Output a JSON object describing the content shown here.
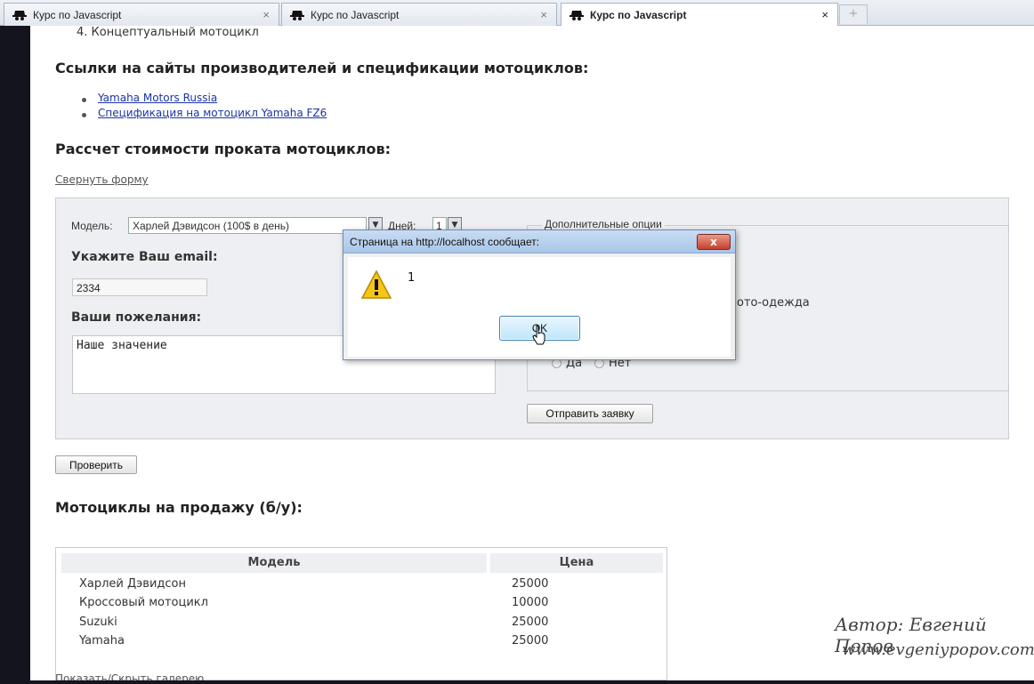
{
  "tabs": [
    {
      "title": "Курс по Javascript",
      "close": "×"
    },
    {
      "title": "Курс по Javascript",
      "close": "×"
    },
    {
      "title": "Курс по Javascript",
      "close": "×"
    }
  ],
  "new_tab": "+",
  "page": {
    "list_item_4": "4.  Концептуальный мотоцикл",
    "links_heading": "Ссылки на сайты производителей и спецификации мотоциклов:",
    "links": [
      "Yamaha Motors Russia",
      "Спецификация на мотоцикл Yamaha FZ6"
    ],
    "calc_heading": "Рассчет стоимости проката мотоциклов:",
    "collapse_link": "Свернуть форму",
    "form": {
      "model_label": "Модель:",
      "model_value": "Харлей Дэвидсон (100$ в день)",
      "days_label": "Дней:",
      "days_value": "1",
      "email_label": "Укажите Ваш email:",
      "email_value": "2334",
      "wishes_label": "Ваши пожелания:",
      "wishes_value": "Наше значение",
      "options_legend": "Дополнительные опции",
      "option_partial": "ото-одежда",
      "radio_yes": "Да",
      "radio_no": "Нет",
      "submit": "Отправить заявку"
    },
    "check_button": "Проверить",
    "sale_heading": "Мотоциклы на продажу (б/у):",
    "table": {
      "headers": [
        "Модель",
        "Цена"
      ],
      "rows": [
        [
          "Харлей Дэвидсон",
          "25000"
        ],
        [
          "Кроссовый мотоцикл",
          "10000"
        ],
        [
          "Suzuki",
          "25000"
        ],
        [
          "Yamaha",
          "25000"
        ]
      ]
    },
    "gallery_link": "Показать/Скрыть галерею"
  },
  "dialog": {
    "title": "Страница на http://localhost сообщает:",
    "close": "x",
    "message": "1",
    "ok": "OK"
  },
  "watermark": {
    "author": "Автор: Евгений Попов",
    "site": "www.evgeniypopov.com"
  }
}
